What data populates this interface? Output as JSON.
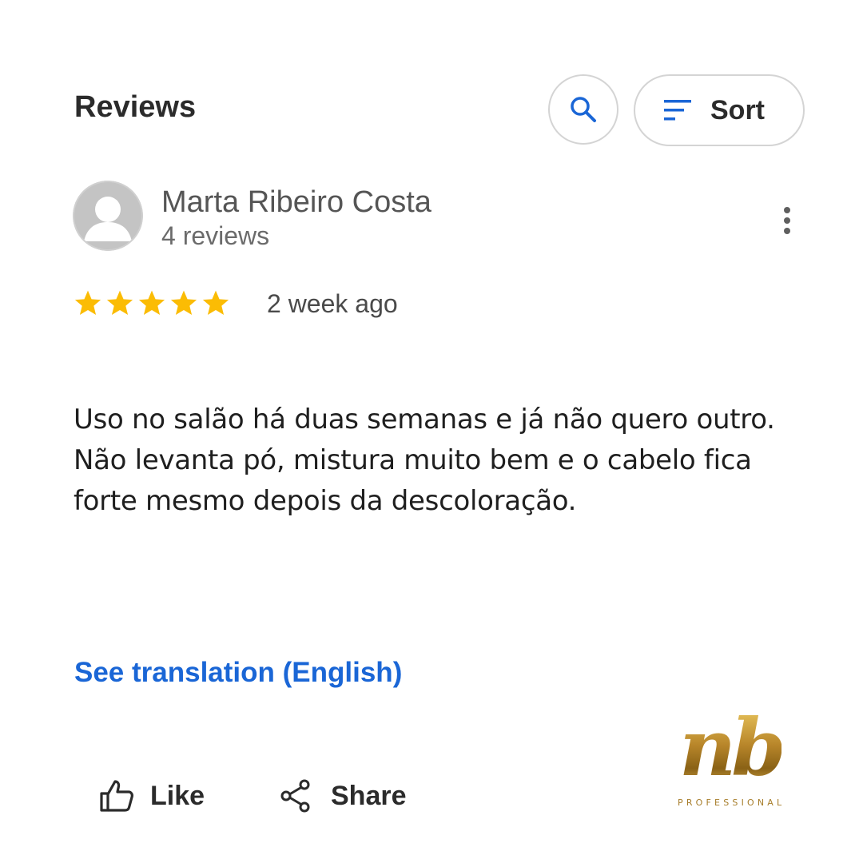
{
  "header": {
    "title": "Reviews",
    "sort_label": "Sort"
  },
  "review": {
    "author_name": "Marta Ribeiro Costa",
    "author_review_count": "4 reviews",
    "rating": 5,
    "rating_max": 5,
    "date": "2 week ago",
    "text": "Uso no salão há duas semanas e já não quero outro.\nNão levanta pó, mistura muito bem e o cabelo fica\nforte mesmo depois da descoloração.",
    "translation_link": "See translation (English)"
  },
  "actions": {
    "like_label": "Like",
    "share_label": "Share"
  },
  "brand": {
    "mark": "nb",
    "subtitle": "PROFESSIONAL"
  },
  "colors": {
    "accent_blue": "#1a66d6",
    "star": "#fbbc04",
    "gold": "#b8862a"
  },
  "icons": {
    "search": "search-icon",
    "sort": "sort-icon",
    "more": "more-vertical-icon",
    "like": "thumbs-up-icon",
    "share": "share-icon",
    "avatar": "user-avatar-icon"
  }
}
